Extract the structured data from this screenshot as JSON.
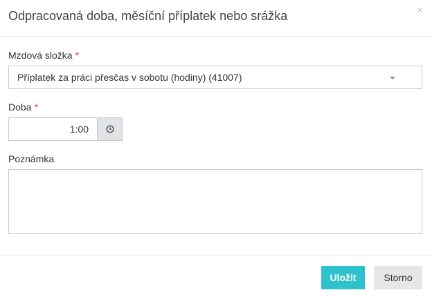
{
  "dialog": {
    "title": "Odpracovaná doba, měsíční příplatek nebo srážka",
    "close_symbol": "×"
  },
  "form": {
    "component": {
      "label": "Mzdová složka",
      "required_mark": "*",
      "selected": "Příplatek za práci přesčas v sobotu (hodiny) (41007)"
    },
    "duration": {
      "label": "Doba",
      "required_mark": "*",
      "value": "1:00",
      "addon_icon": "clock-icon"
    },
    "note": {
      "label": "Poznámka",
      "value": ""
    }
  },
  "footer": {
    "save_label": "Uložit",
    "cancel_label": "Storno"
  },
  "colors": {
    "primary": "#2dc2cc",
    "required": "#e0413a",
    "addon_bg": "#e1e3e6",
    "cancel_bg": "#e6e6e6"
  }
}
